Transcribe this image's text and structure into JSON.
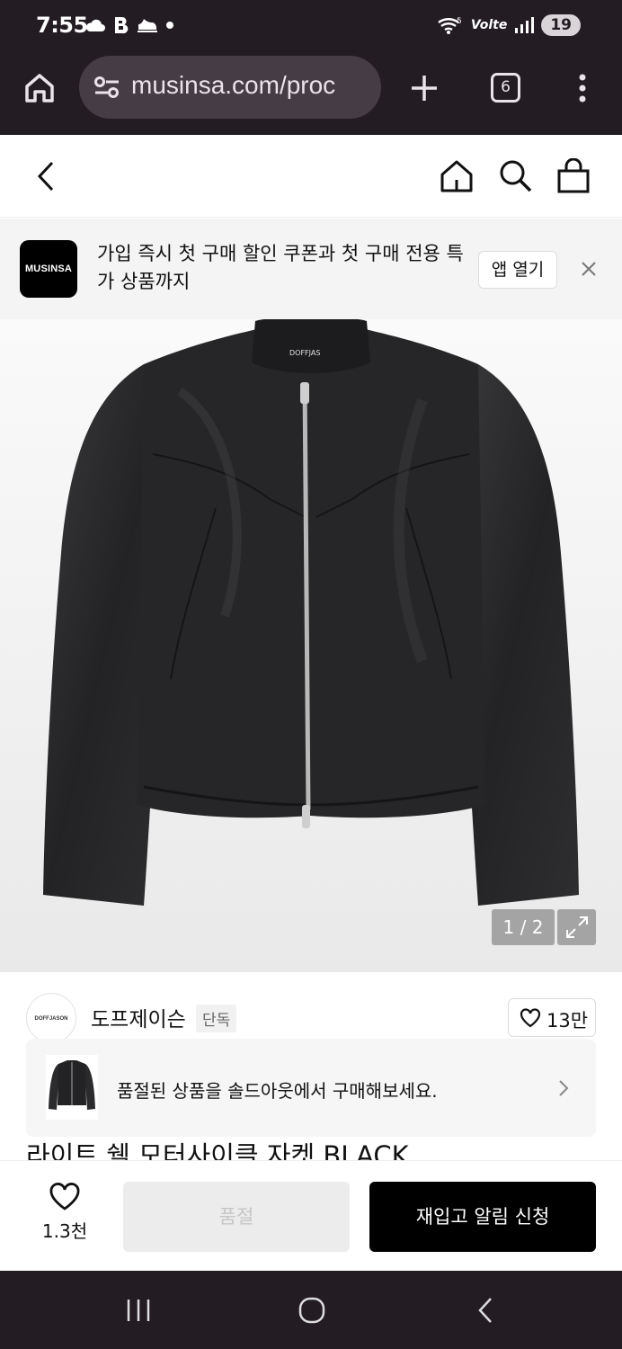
{
  "status_bar": {
    "time": "7:55",
    "network": "Volte",
    "battery": "19"
  },
  "browser": {
    "url": "musinsa.com/proc",
    "tab_count": "6"
  },
  "app_banner": {
    "logo_text": "MUSINSA",
    "message": "가입 즉시 첫 구매 할인 쿠폰과 첫 구매 전용 특가 상품까지",
    "open_app_label": "앱 열기"
  },
  "gallery": {
    "counter": "1 / 2",
    "jacket_label": "DOFFJAS"
  },
  "brand": {
    "logo_text": "DOFFJASON",
    "name": "도프제이슨",
    "badge": "단독",
    "likes": "13만"
  },
  "soldout_notice": {
    "text": "품절된 상품을 솔드아웃에서 구매해보세요."
  },
  "product": {
    "title": "라이트 쉘 모터사이클 자켓 BLACK"
  },
  "action_bar": {
    "wish_count": "1.3천",
    "soldout_label": "품절",
    "restock_label": "재입고 알림 신청"
  },
  "colors": {
    "system_bar": "#231c23",
    "url_pill": "#463c45",
    "primary_button": "#000000",
    "disabled_button": "#ececec"
  }
}
